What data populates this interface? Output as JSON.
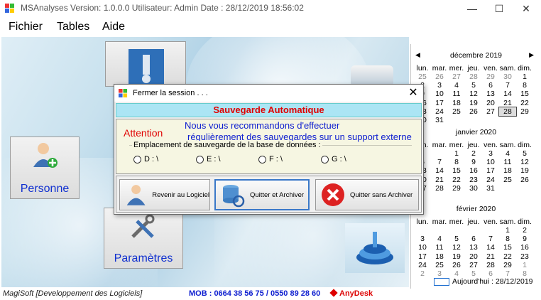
{
  "window": {
    "title": "MSAnalyses Version: 1.0.0.0   Utilisateur: Admin   Date : 28/12/2019 18:56:02",
    "controls": {
      "minimize": "—",
      "maximize": "☐",
      "close": "✕"
    }
  },
  "menu": {
    "items": [
      "Fichier",
      "Tables",
      "Aide"
    ]
  },
  "tiles": {
    "personne": "Personne",
    "parametres": "Paramètres"
  },
  "calendar": {
    "months": [
      {
        "title": "décembre 2019",
        "weekdays": [
          "lun.",
          "mar.",
          "mer.",
          "jeu.",
          "ven.",
          "sam.",
          "dim."
        ],
        "weeks": [
          [
            "25",
            "26",
            "27",
            "28",
            "29",
            "30",
            "1"
          ],
          [
            "2",
            "3",
            "4",
            "5",
            "6",
            "7",
            "8"
          ],
          [
            "9",
            "10",
            "11",
            "12",
            "13",
            "14",
            "15"
          ],
          [
            "16",
            "17",
            "18",
            "19",
            "20",
            "21",
            "22"
          ],
          [
            "23",
            "24",
            "25",
            "26",
            "27",
            "28",
            "29"
          ],
          [
            "30",
            "31",
            "",
            "",
            "",
            "",
            ""
          ]
        ]
      },
      {
        "title": "janvier 2020",
        "weekdays": [
          "lun.",
          "mar.",
          "mer.",
          "jeu.",
          "ven.",
          "sam.",
          "dim."
        ],
        "weeks": [
          [
            "",
            "",
            "1",
            "2",
            "3",
            "4",
            "5"
          ],
          [
            "6",
            "7",
            "8",
            "9",
            "10",
            "11",
            "12"
          ],
          [
            "13",
            "14",
            "15",
            "16",
            "17",
            "18",
            "19"
          ],
          [
            "20",
            "21",
            "22",
            "23",
            "24",
            "25",
            "26"
          ],
          [
            "27",
            "28",
            "29",
            "30",
            "31",
            "",
            ""
          ]
        ]
      },
      {
        "title": "février 2020",
        "weekdays": [
          "lun.",
          "mar.",
          "mer.",
          "jeu.",
          "ven.",
          "sam.",
          "dim."
        ],
        "weeks": [
          [
            "",
            "",
            "",
            "",
            "",
            "1",
            "2"
          ],
          [
            "3",
            "4",
            "5",
            "6",
            "7",
            "8",
            "9"
          ],
          [
            "10",
            "11",
            "12",
            "13",
            "14",
            "15",
            "16"
          ],
          [
            "17",
            "18",
            "19",
            "20",
            "21",
            "22",
            "23"
          ],
          [
            "24",
            "25",
            "26",
            "27",
            "28",
            "29",
            "1"
          ],
          [
            "2",
            "3",
            "4",
            "5",
            "6",
            "7",
            "8"
          ]
        ]
      }
    ],
    "today_label": "Aujourd'hui : 28/12/2019",
    "nav_prev": "◀",
    "nav_next": "▶"
  },
  "statusbar": {
    "company": "MagiSoft [Developpement des Logiciels]",
    "phone": "MOB : 0664 38 56 75 / 0550 89 28 60",
    "anydesk": "AnyDesk"
  },
  "dialog": {
    "title": "Fermer la session . . .",
    "close": "✕",
    "banner": "Sauvegarde Automatique",
    "attention": "Attention",
    "message_line1": "Nous vous recommandons d'effectuer",
    "message_line2": "régulièrement des sauvegardes sur un support externe",
    "group_title": "Emplacement de sauvegarde de la base de données :",
    "drives": [
      "D : \\",
      "E : \\",
      "F : \\",
      "G : \\"
    ],
    "buttons": {
      "back": "Revenir au Logiciel",
      "quit_archive": "Quitter et Archiver",
      "quit_no_archive": "Quitter sans Archiver"
    }
  },
  "colors": {
    "link_blue": "#1030d0",
    "alert_red": "#e00000",
    "banner_bg": "#abe5f4",
    "panel_bg": "#f6f6e2"
  }
}
